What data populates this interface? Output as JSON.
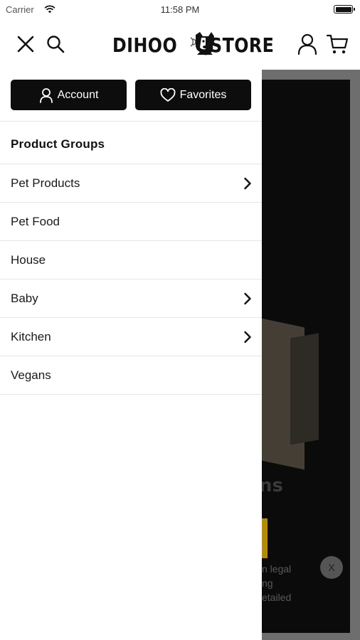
{
  "status_bar": {
    "carrier": "Carrier",
    "time": "11:58 PM"
  },
  "header": {
    "logo_left": "DIHOO",
    "logo_right": "STORE",
    "icons": [
      "close-icon",
      "search-icon",
      "user-icon",
      "cart-icon"
    ]
  },
  "drawer": {
    "account_label": "Account",
    "favorites_label": "Favorites",
    "section_title": "Product Groups",
    "items": [
      {
        "label": "Pet Products",
        "has_children": true
      },
      {
        "label": "Pet Food",
        "has_children": false
      },
      {
        "label": "House",
        "has_children": false
      },
      {
        "label": "Baby",
        "has_children": true
      },
      {
        "label": "Kitchen",
        "has_children": true
      },
      {
        "label": "Vegans",
        "has_children": false
      }
    ]
  },
  "background": {
    "hero_word": "ns",
    "legal_lines": [
      "n legal",
      "ng",
      "etailed"
    ],
    "close_label": "X"
  },
  "colors": {
    "button_bg": "#0d0d0d",
    "overlay": "#6e6e6e",
    "accent_yellow": "#b38d00"
  }
}
